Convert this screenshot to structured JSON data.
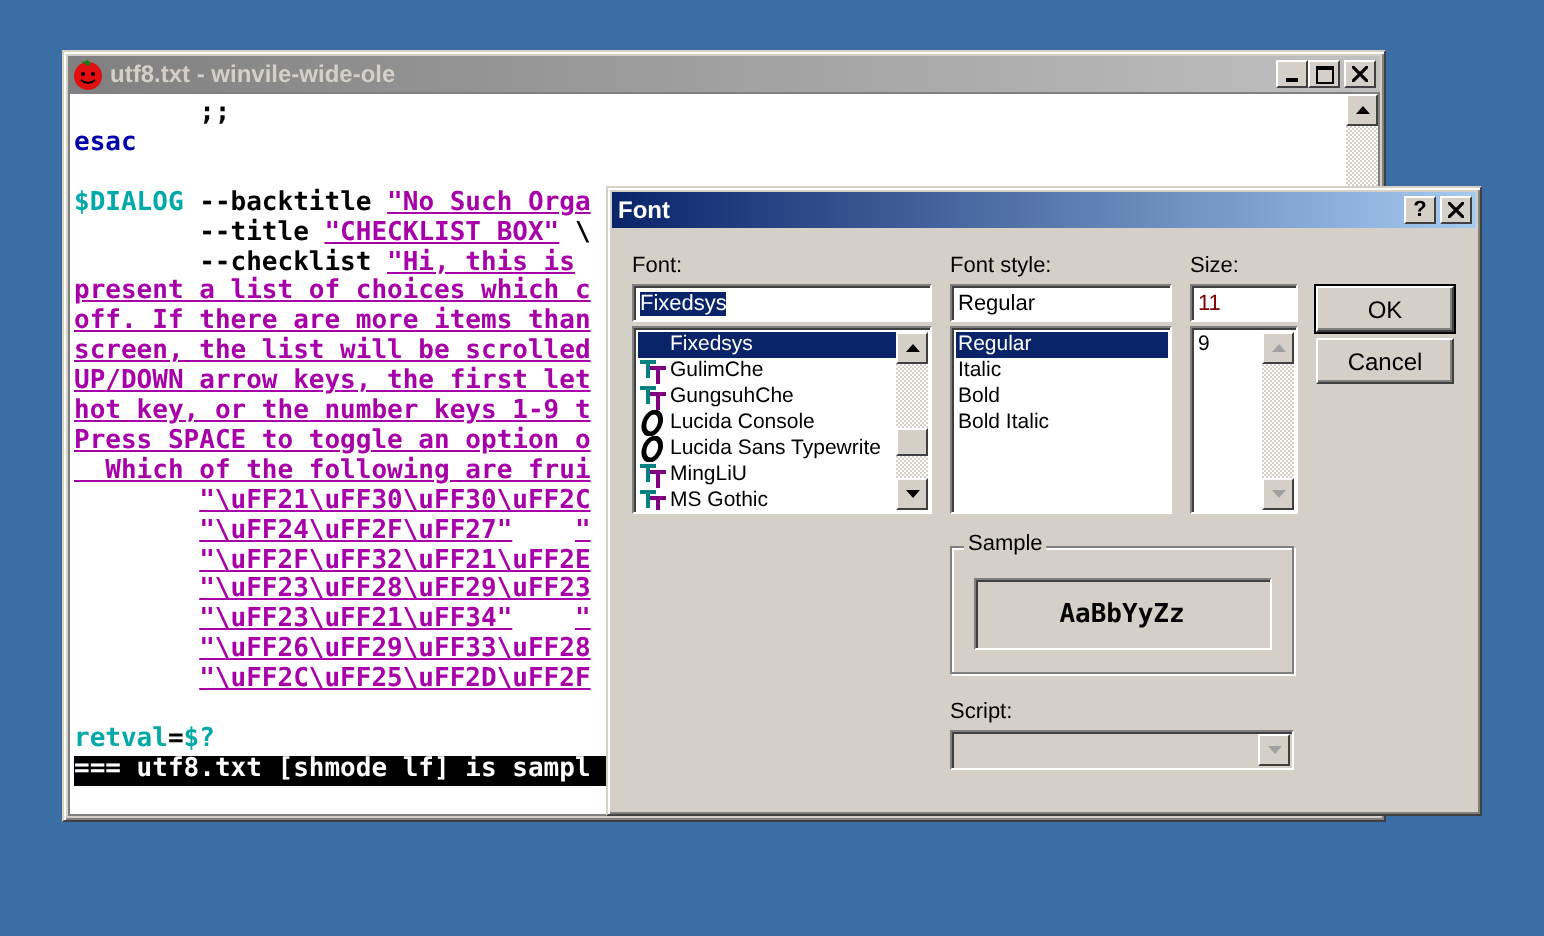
{
  "editor_window": {
    "title": "utf8.txt - winvile-wide-ole",
    "lines": [
      {
        "indented": true,
        "space_before": false,
        "segments": [
          {
            "kind": "plain",
            "text": ";;"
          }
        ]
      },
      {
        "indented": false,
        "space_before": false,
        "segments": [
          {
            "kind": "keyword",
            "text": "esac"
          }
        ]
      },
      {
        "indented": false,
        "space_before": true,
        "segments": [
          {
            "kind": "variable",
            "text": "$DIALOG"
          },
          {
            "kind": "plain",
            "text": " --backtitle "
          },
          {
            "kind": "string",
            "text": "\"No Such Orga"
          }
        ]
      },
      {
        "indented": true,
        "space_before": false,
        "segments": [
          {
            "kind": "plain",
            "text": "--title "
          },
          {
            "kind": "string",
            "text": "\"CHECKLIST BOX\""
          },
          {
            "kind": "plain",
            "text": " \\"
          }
        ]
      },
      {
        "indented": true,
        "space_before": false,
        "segments": [
          {
            "kind": "plain",
            "text": "--checklist "
          },
          {
            "kind": "string",
            "text": "\"Hi, this is"
          }
        ]
      },
      {
        "indented": false,
        "space_before": false,
        "segments": [
          {
            "kind": "string",
            "text": "present a list of choices which c"
          }
        ]
      },
      {
        "indented": false,
        "space_before": false,
        "segments": [
          {
            "kind": "string",
            "text": "off. If there are more items than"
          }
        ]
      },
      {
        "indented": false,
        "space_before": false,
        "segments": [
          {
            "kind": "string",
            "text": "screen, the list will be scrolled"
          }
        ]
      },
      {
        "indented": false,
        "space_before": false,
        "segments": [
          {
            "kind": "string",
            "text": "UP/DOWN arrow keys, the first let"
          }
        ]
      },
      {
        "indented": false,
        "space_before": false,
        "segments": [
          {
            "kind": "string",
            "text": "hot key, or the number keys 1-9 t"
          }
        ]
      },
      {
        "indented": false,
        "space_before": false,
        "segments": [
          {
            "kind": "string",
            "text": "Press SPACE to toggle an option o"
          }
        ]
      },
      {
        "indented": false,
        "space_before": false,
        "segments": [
          {
            "kind": "string",
            "text": "  Which of the following are frui"
          }
        ]
      },
      {
        "indented": true,
        "space_before": false,
        "segments": [
          {
            "kind": "string",
            "text": "\"\\uFF21\\uFF30\\uFF30\\uFF2C"
          }
        ]
      },
      {
        "indented": true,
        "space_before": false,
        "segments": [
          {
            "kind": "string",
            "text": "\"\\uFF24\\uFF2F\\uFF27\""
          },
          {
            "kind": "gap"
          },
          {
            "kind": "string",
            "text": "\""
          }
        ]
      },
      {
        "indented": true,
        "space_before": false,
        "segments": [
          {
            "kind": "string",
            "text": "\"\\uFF2F\\uFF32\\uFF21\\uFF2E"
          }
        ]
      },
      {
        "indented": true,
        "space_before": false,
        "segments": [
          {
            "kind": "string",
            "text": "\"\\uFF23\\uFF28\\uFF29\\uFF23"
          }
        ]
      },
      {
        "indented": true,
        "space_before": false,
        "segments": [
          {
            "kind": "string",
            "text": "\"\\uFF23\\uFF21\\uFF34\""
          },
          {
            "kind": "gap"
          },
          {
            "kind": "string",
            "text": "\""
          }
        ]
      },
      {
        "indented": true,
        "space_before": false,
        "segments": [
          {
            "kind": "string",
            "text": "\"\\uFF26\\uFF29\\uFF33\\uFF28"
          }
        ]
      },
      {
        "indented": true,
        "space_before": false,
        "segments": [
          {
            "kind": "string",
            "text": "\"\\uFF2C\\uFF25\\uFF2D\\uFF2F"
          }
        ]
      },
      {
        "indented": false,
        "space_before": true,
        "segments": [
          {
            "kind": "variable",
            "text": "retval"
          },
          {
            "kind": "plain",
            "text": "="
          },
          {
            "kind": "variable",
            "text": "$?"
          }
        ]
      }
    ],
    "status_line": "=== utf8.txt [shmode lf] is sampl"
  },
  "font_dialog": {
    "title": "Font",
    "help_button": "?",
    "font": {
      "label": "Font:",
      "value": "Fixedsys",
      "items": [
        {
          "name": "Fixedsys",
          "kind": "raster",
          "selected": true
        },
        {
          "name": "GulimChe",
          "kind": "truetype",
          "selected": false
        },
        {
          "name": "GungsuhChe",
          "kind": "truetype",
          "selected": false
        },
        {
          "name": "Lucida Console",
          "kind": "opentype",
          "selected": false
        },
        {
          "name": "Lucida Sans Typewrite",
          "kind": "opentype",
          "selected": false
        },
        {
          "name": "MingLiU",
          "kind": "truetype",
          "selected": false
        },
        {
          "name": "MS Gothic",
          "kind": "truetype",
          "selected": false
        }
      ]
    },
    "font_style": {
      "label": "Font style:",
      "value": "Regular",
      "items": [
        {
          "name": "Regular",
          "selected": true
        },
        {
          "name": "Italic",
          "selected": false
        },
        {
          "name": "Bold",
          "selected": false
        },
        {
          "name": "Bold Italic",
          "selected": false
        }
      ]
    },
    "size": {
      "label": "Size:",
      "value": "11",
      "items": [
        {
          "name": "9",
          "selected": false
        }
      ]
    },
    "buttons": [
      "OK",
      "Cancel"
    ],
    "sample": {
      "label": "Sample",
      "text": "AaBbYyZz"
    },
    "script": {
      "label": "Script:"
    }
  }
}
